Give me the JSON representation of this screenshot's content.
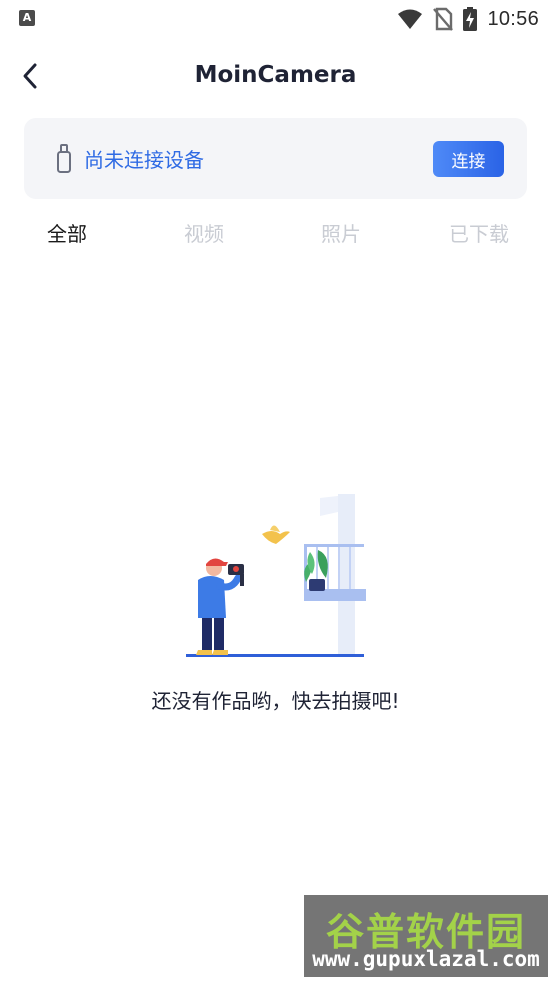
{
  "status_bar": {
    "app_icon": "A",
    "time": "10:56",
    "icons": [
      "wifi-icon",
      "no-sim-icon",
      "battery-charging-icon"
    ]
  },
  "header": {
    "title": "MoinCamera",
    "back_icon": "chevron-left-icon"
  },
  "device": {
    "icon": "usb-stick-icon",
    "status": "尚未连接设备",
    "connect_label": "连接",
    "status_color": "#2f6be4",
    "button_color": "#3a74ee"
  },
  "tabs": [
    {
      "label": "全部",
      "active": true
    },
    {
      "label": "视频",
      "active": false
    },
    {
      "label": "照片",
      "active": false
    },
    {
      "label": "已下载",
      "active": false
    }
  ],
  "empty_state": {
    "illustration": "photographer-balcony-illustration",
    "message": "还没有作品哟，快去拍摄吧!"
  },
  "watermark": {
    "brand": "谷普软件园",
    "url": "www.gupuxlazal.com"
  }
}
